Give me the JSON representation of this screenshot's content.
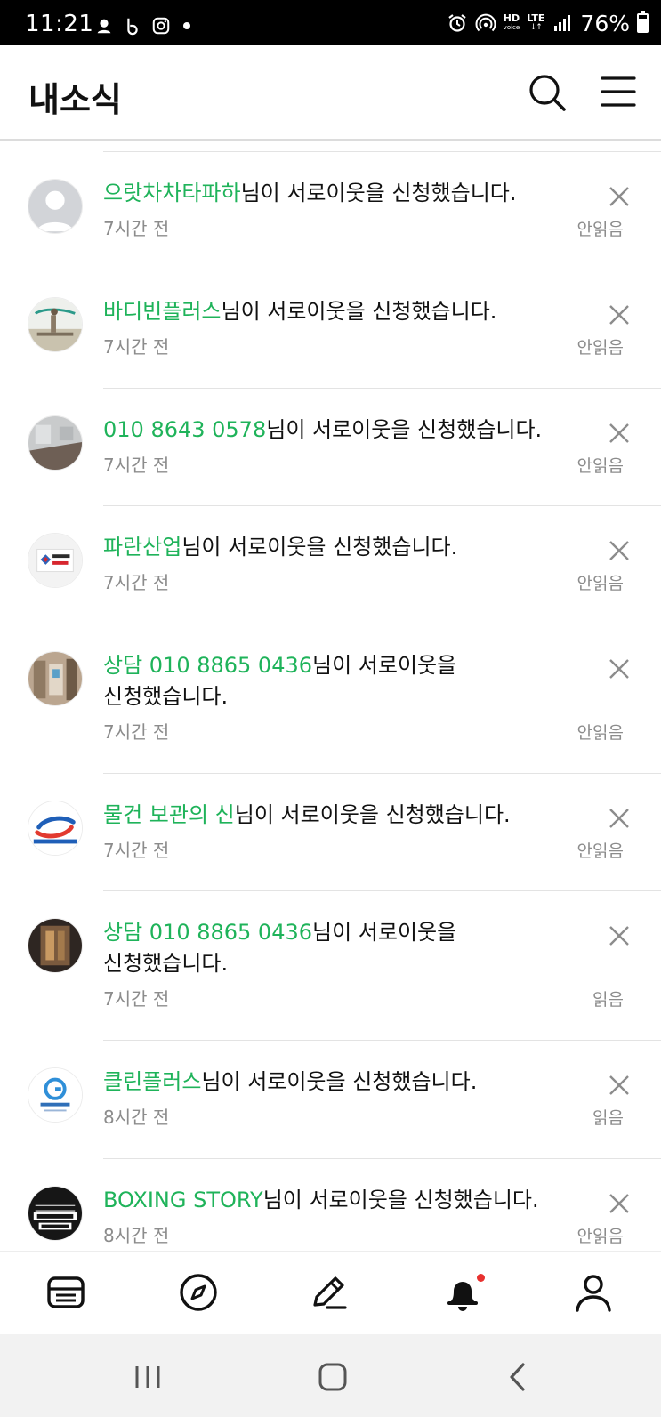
{
  "status_bar": {
    "time": "11:21",
    "battery": "76%",
    "network_hd": "HD",
    "network_voice": "voice",
    "network_lte": "LTE"
  },
  "header": {
    "title": "내소식"
  },
  "colors": {
    "nickname_green": "#1fb35a",
    "badge_red": "#e8312f"
  },
  "notifications": [
    {
      "nickname": "으랏차차타파하",
      "message": "님이 서로이웃을 신청했습니다.",
      "time": "7시간 전",
      "status": "안읽음",
      "avatar": "default-profile"
    },
    {
      "nickname": "바디빈플러스",
      "message": "님이 서로이웃을 신청했습니다.",
      "time": "7시간 전",
      "status": "안읽음",
      "avatar": "gym-photo"
    },
    {
      "nickname": "010 8643 0578",
      "message": "님이 서로이웃을 신청했습니다.",
      "time": "7시간 전",
      "status": "안읽음",
      "avatar": "room-photo"
    },
    {
      "nickname": "파란산업",
      "message": "님이 서로이웃을 신청했습니다.",
      "time": "7시간 전",
      "status": "안읽음",
      "avatar": "company-logo"
    },
    {
      "nickname": "상담 010 8865 0436",
      "message": "님이 서로이웃을 신청했습니다.",
      "time": "7시간 전",
      "status": "안읽음",
      "avatar": "interior-photo"
    },
    {
      "nickname": "물건 보관의 신",
      "message": "님이 서로이웃을 신청했습니다.",
      "time": "7시간 전",
      "status": "안읽음",
      "avatar": "logistics-logo"
    },
    {
      "nickname": "상담 010 8865 0436",
      "message": "님이 서로이웃을 신청했습니다.",
      "time": "7시간 전",
      "status": "읽음",
      "avatar": "storage-photo"
    },
    {
      "nickname": "클린플러스",
      "message": "님이 서로이웃을 신청했습니다.",
      "time": "8시간 전",
      "status": "읽음",
      "avatar": "cleaning-logo"
    },
    {
      "nickname": "BOXING STORY",
      "message": "님이 서로이웃을 신청했습니다.",
      "time": "8시간 전",
      "status": "안읽음",
      "avatar": "boxing-logo"
    }
  ],
  "bottom_nav": [
    {
      "name": "feed",
      "icon": "feed-icon"
    },
    {
      "name": "discover",
      "icon": "compass-icon"
    },
    {
      "name": "write",
      "icon": "pencil-icon"
    },
    {
      "name": "news",
      "icon": "bell-icon",
      "has_badge": true
    },
    {
      "name": "my",
      "icon": "person-icon"
    }
  ],
  "system_nav": [
    {
      "name": "recent-apps",
      "icon": "recent-apps-icon"
    },
    {
      "name": "home",
      "icon": "home-icon"
    },
    {
      "name": "back",
      "icon": "back-icon"
    }
  ]
}
